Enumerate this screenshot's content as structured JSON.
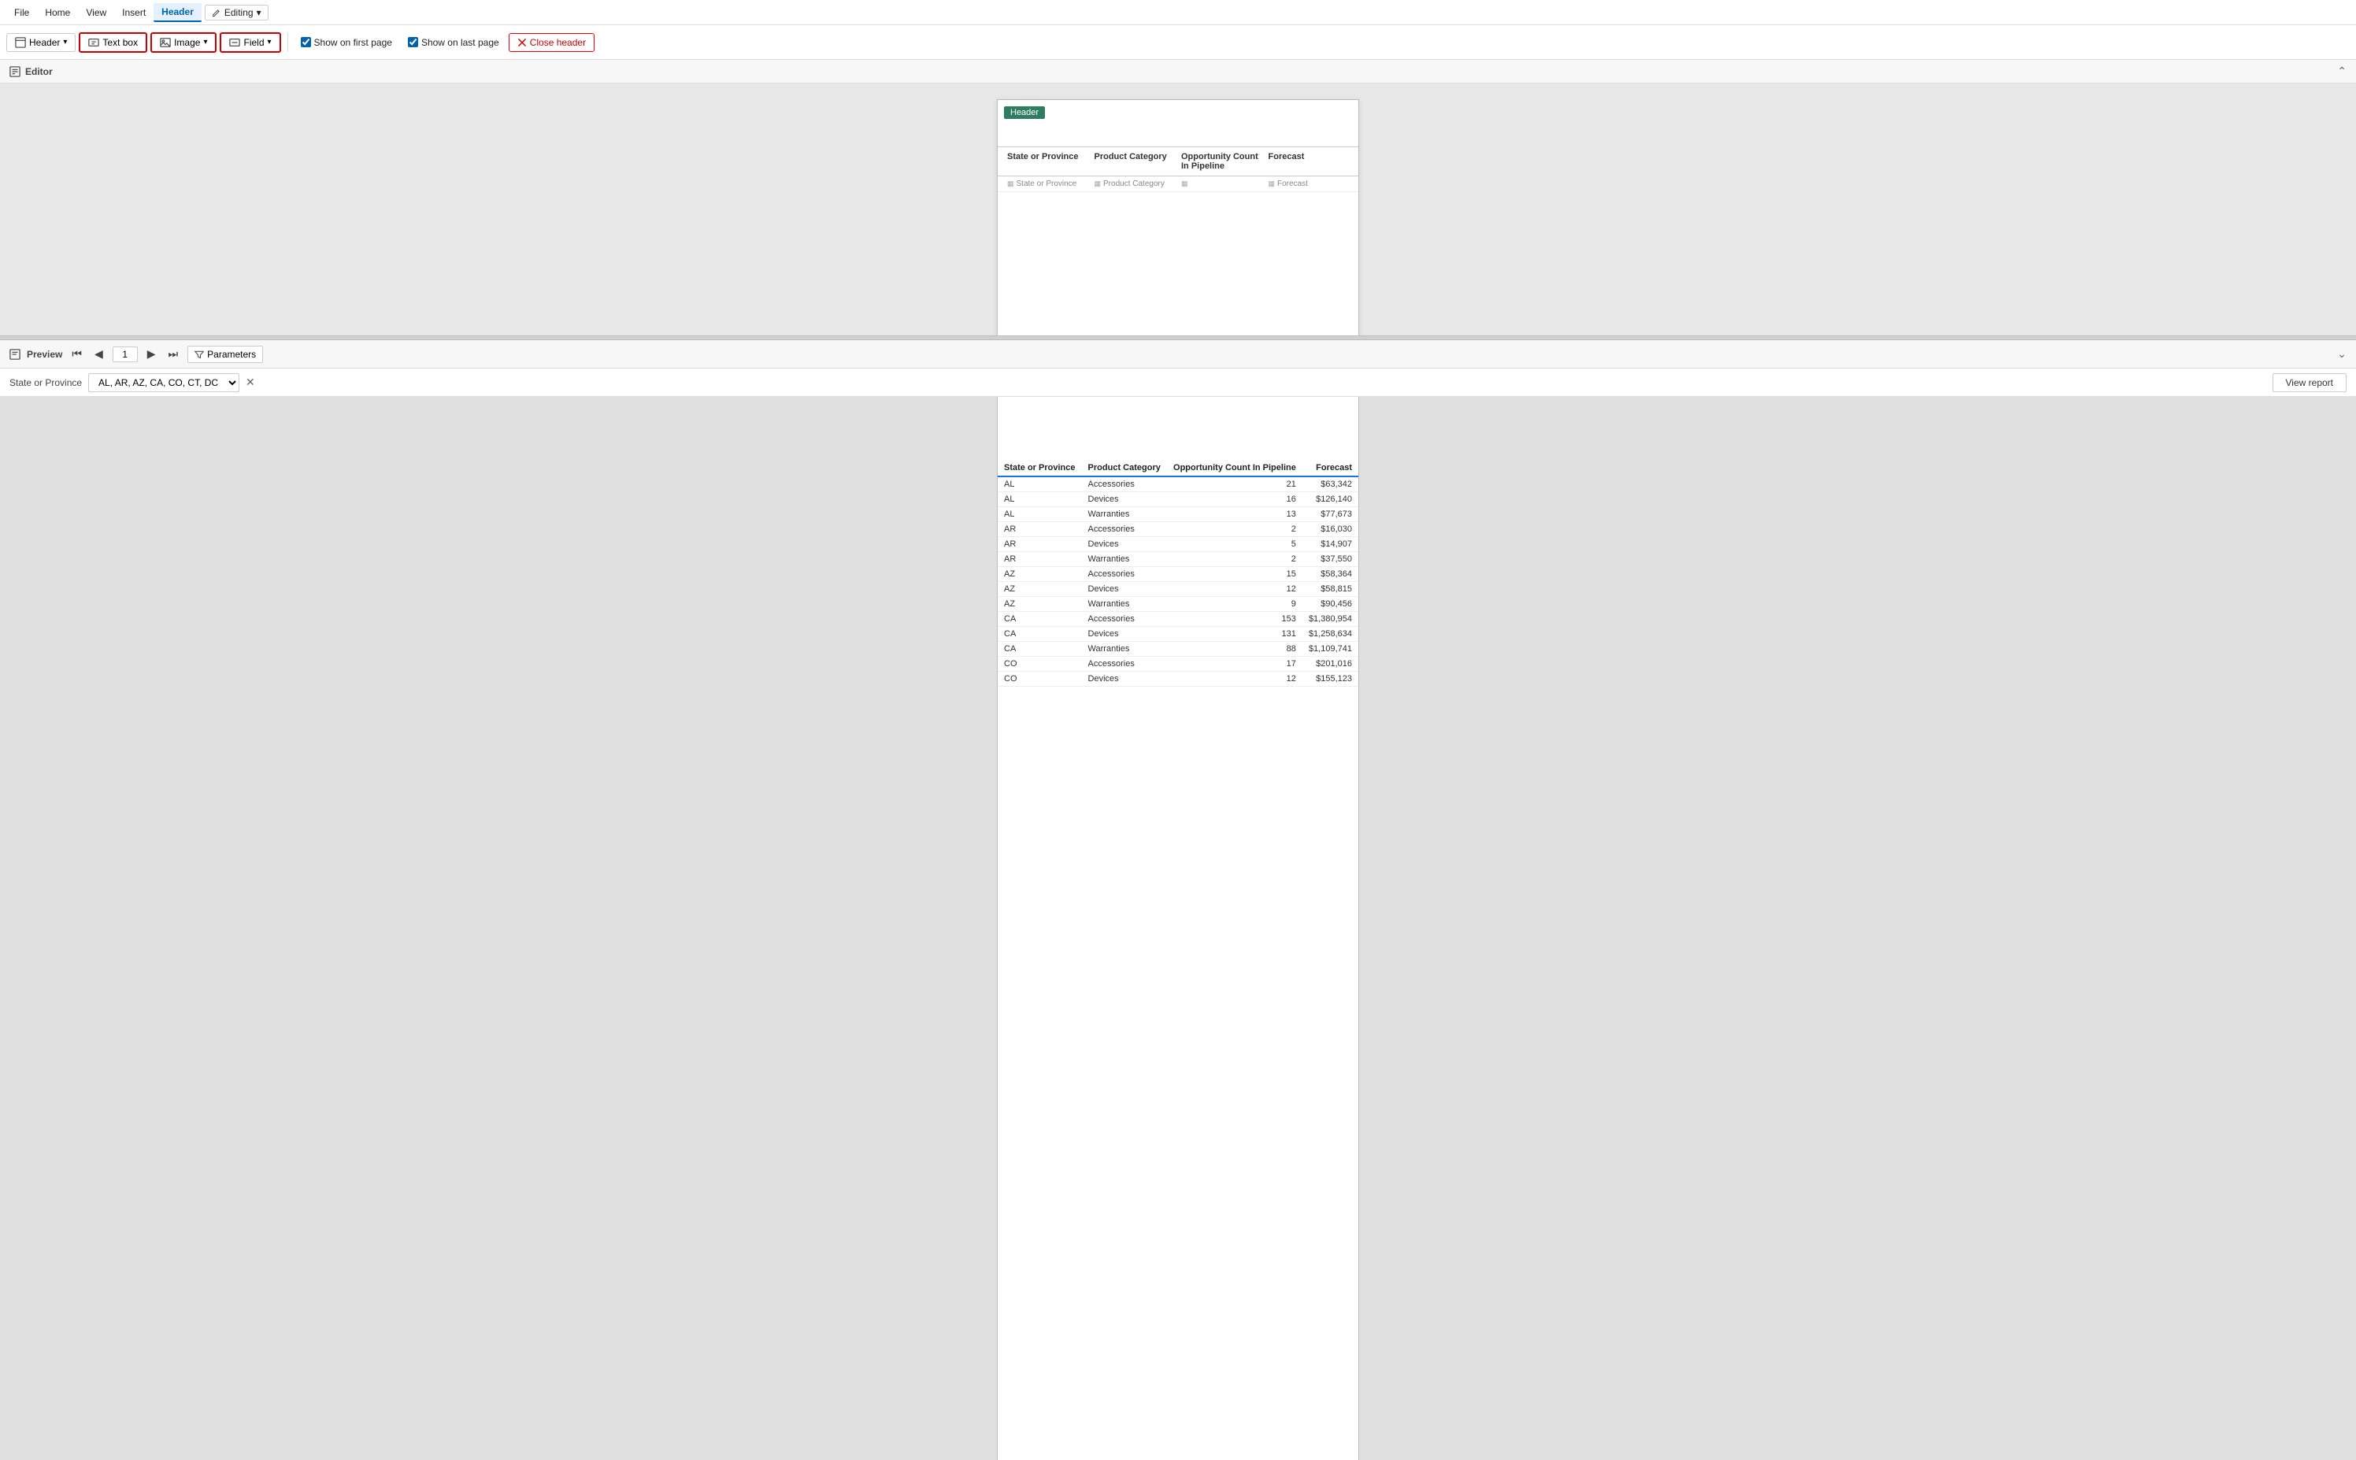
{
  "menubar": {
    "items": [
      "File",
      "Home",
      "View",
      "Insert",
      "Header"
    ],
    "editing_label": "Editing"
  },
  "toolbar": {
    "header_label": "Header",
    "textbox_label": "Text box",
    "image_label": "Image",
    "field_label": "Field",
    "show_first_label": "Show on first page",
    "show_last_label": "Show on last page",
    "close_header_label": "Close header",
    "show_first_checked": true,
    "show_last_checked": true
  },
  "editor": {
    "section_label": "Editor",
    "header_badge": "Header",
    "columns": [
      {
        "label": "State or Province",
        "field": "State or Province"
      },
      {
        "label": "Product Category",
        "field": "Product Category"
      },
      {
        "label": "Opportunity Count In Pipeline",
        "field": ""
      },
      {
        "label": "Forecast",
        "field": "Forecast"
      }
    ]
  },
  "preview": {
    "section_label": "Preview",
    "page_number": "1",
    "params_label": "Parameters",
    "state_param_label": "State or Province",
    "state_param_value": "AL, AR, AZ, CA, CO, CT, DC",
    "view_report_label": "View report",
    "table": {
      "headers": [
        "State or Province",
        "Product Category",
        "Opportunity Count In Pipeline",
        "Forecast"
      ],
      "rows": [
        [
          "AL",
          "Accessories",
          "21",
          "$63,342"
        ],
        [
          "AL",
          "Devices",
          "16",
          "$126,140"
        ],
        [
          "AL",
          "Warranties",
          "13",
          "$77,673"
        ],
        [
          "AR",
          "Accessories",
          "2",
          "$16,030"
        ],
        [
          "AR",
          "Devices",
          "5",
          "$14,907"
        ],
        [
          "AR",
          "Warranties",
          "2",
          "$37,550"
        ],
        [
          "AZ",
          "Accessories",
          "15",
          "$58,364"
        ],
        [
          "AZ",
          "Devices",
          "12",
          "$58,815"
        ],
        [
          "AZ",
          "Warranties",
          "9",
          "$90,456"
        ],
        [
          "CA",
          "Accessories",
          "153",
          "$1,380,954"
        ],
        [
          "CA",
          "Devices",
          "131",
          "$1,258,634"
        ],
        [
          "CA",
          "Warranties",
          "88",
          "$1,109,741"
        ],
        [
          "CO",
          "Accessories",
          "17",
          "$201,016"
        ],
        [
          "CO",
          "Devices",
          "12",
          "$155,123"
        ]
      ]
    }
  }
}
